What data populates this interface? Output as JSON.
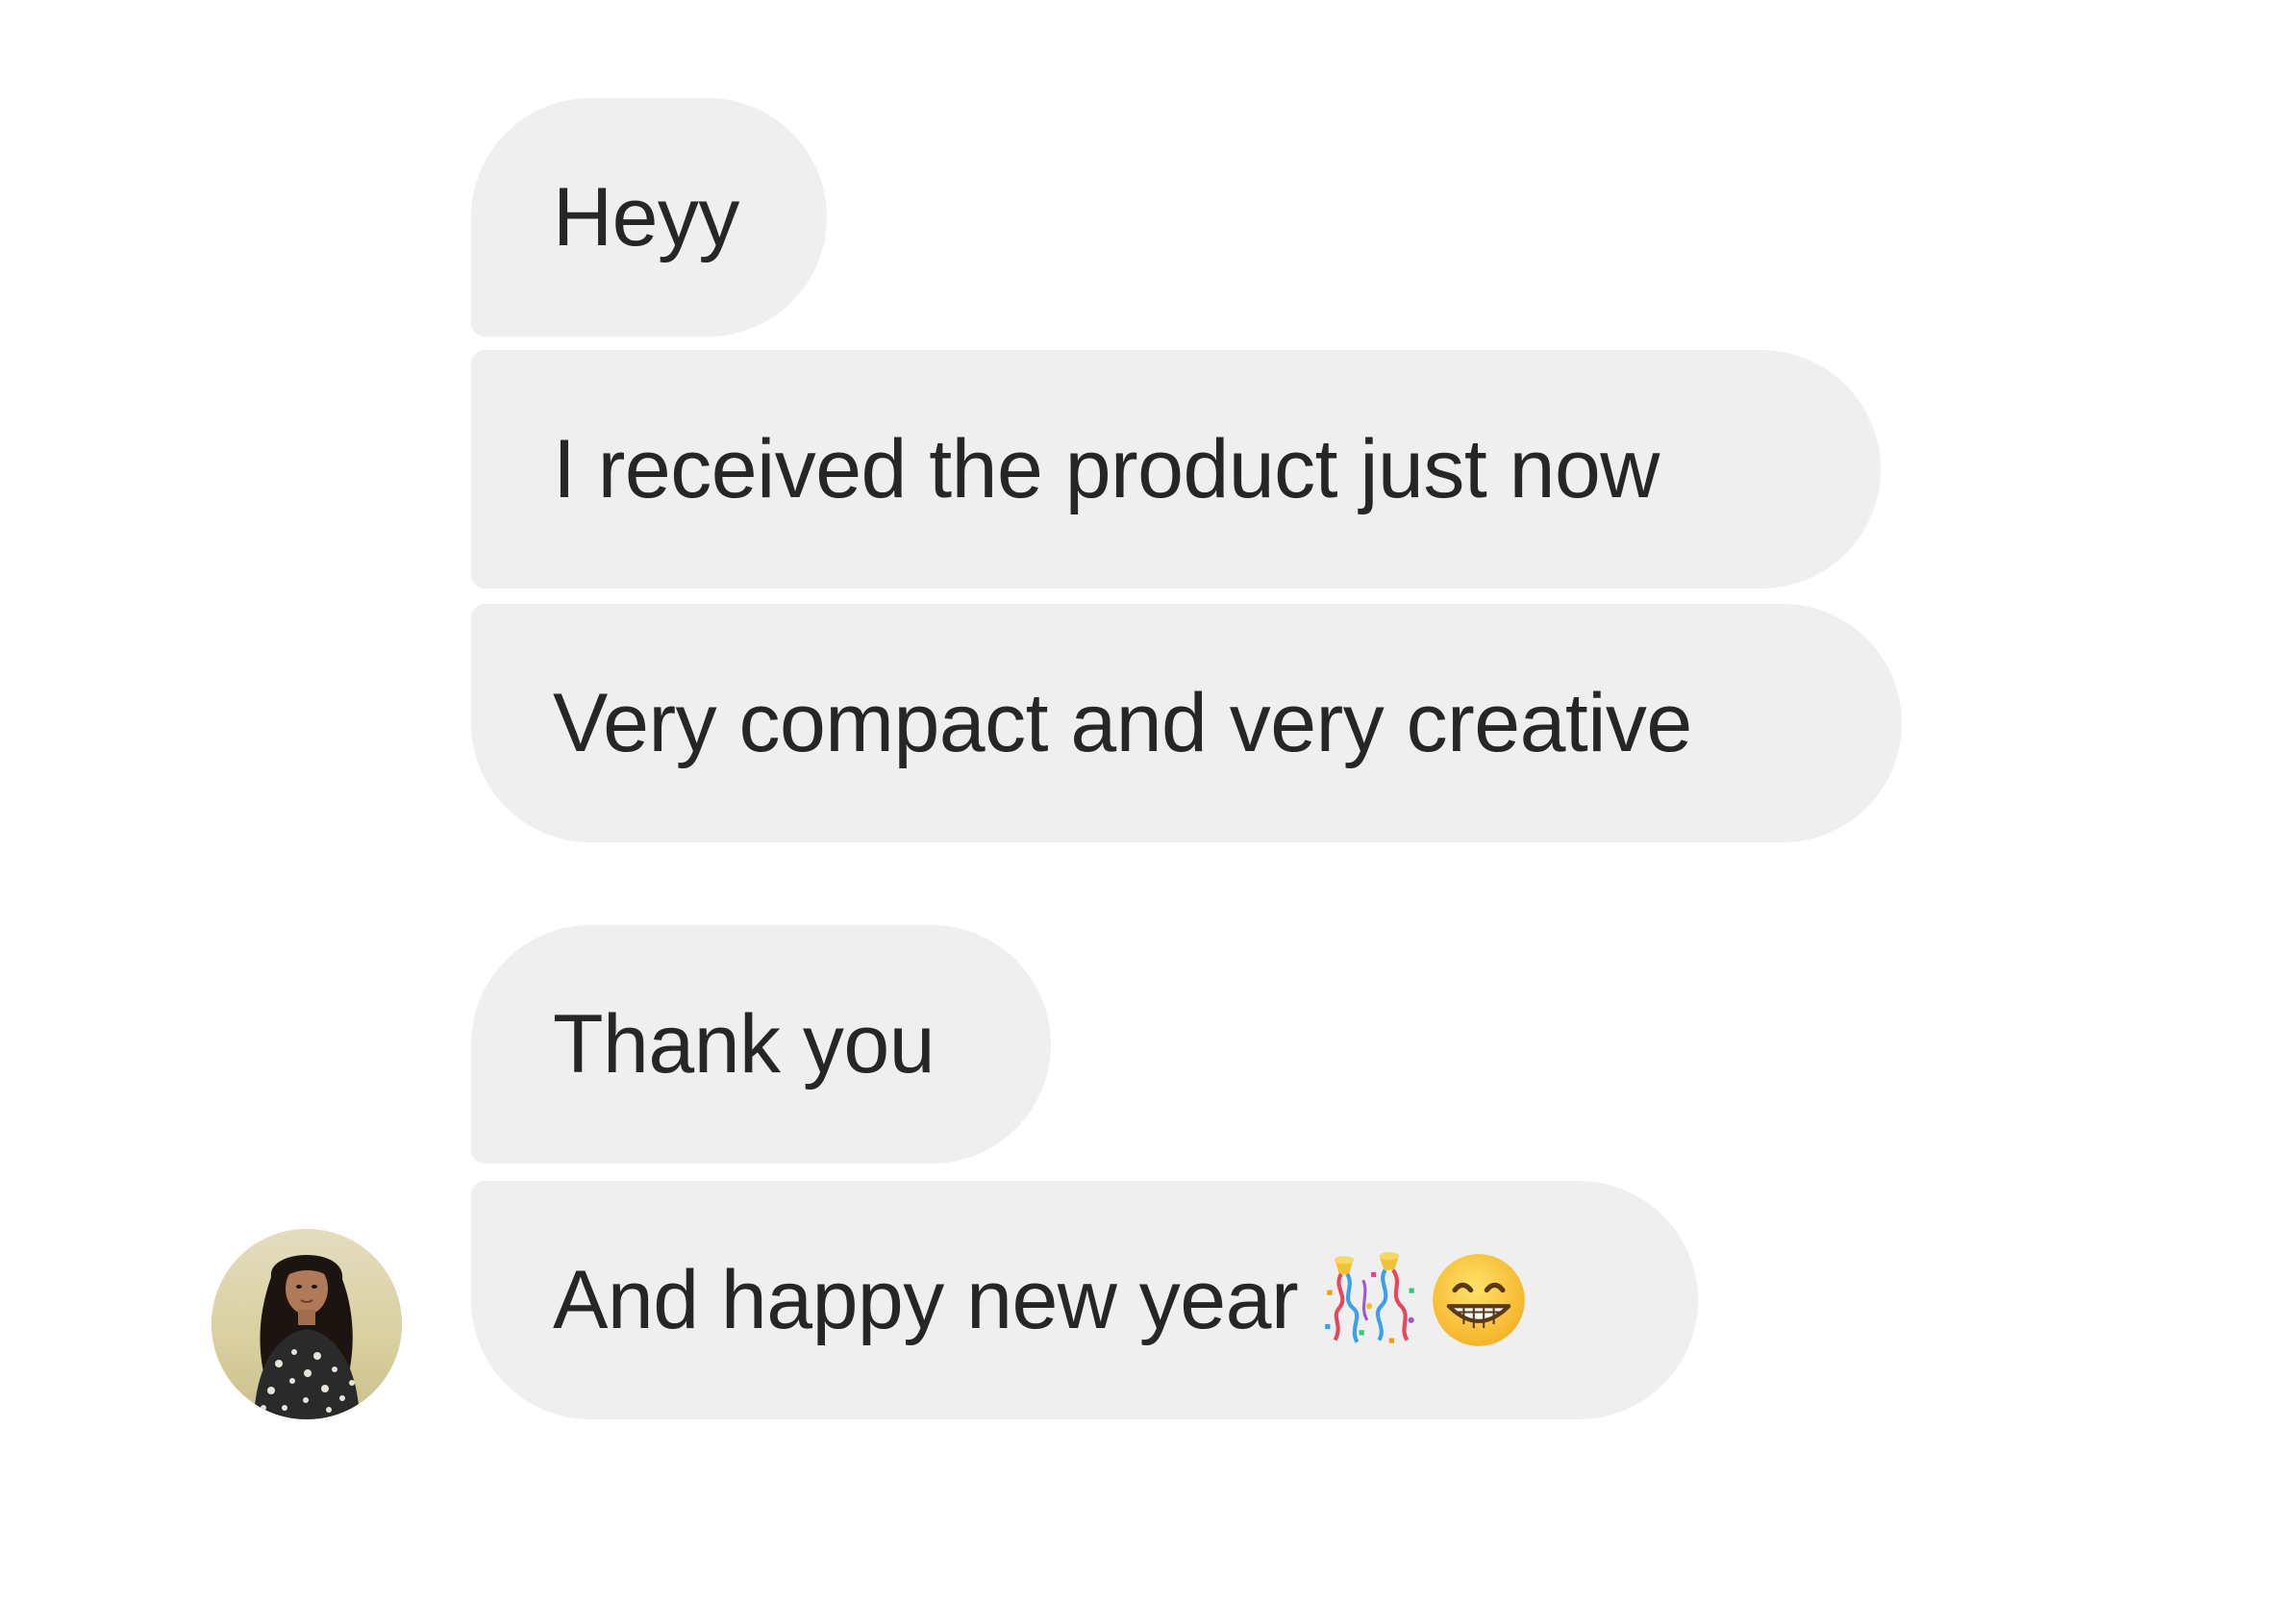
{
  "conversation": {
    "messages": [
      {
        "text": "Heyy"
      },
      {
        "text": "I received the product just now"
      },
      {
        "text": "Very compact and very creative"
      },
      {
        "text": "Thank you"
      },
      {
        "text": "And happy new year",
        "emojis": [
          "party-popper-icon",
          "grinning-face-icon"
        ]
      }
    ]
  },
  "colors": {
    "bubble_bg": "#efefef",
    "text": "#262626",
    "background": "#ffffff"
  }
}
